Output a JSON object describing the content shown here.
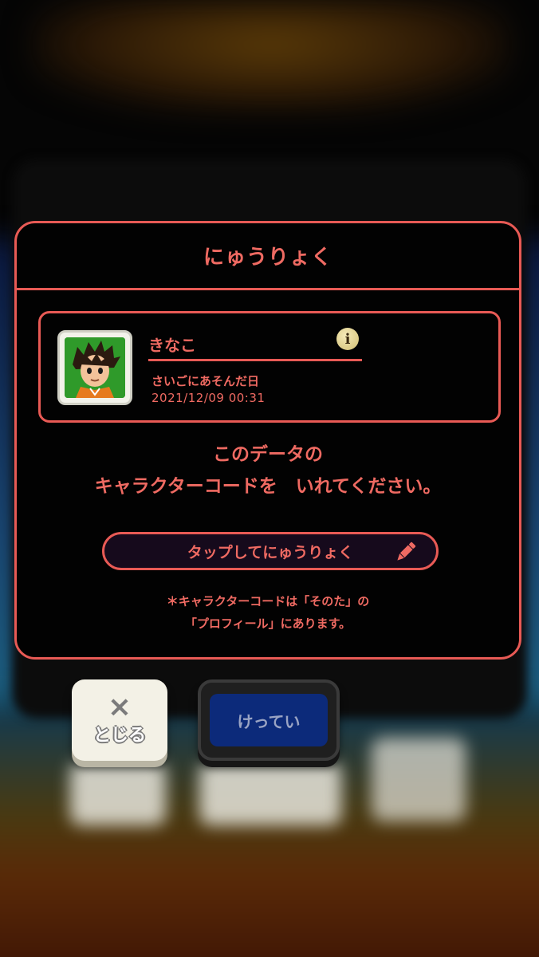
{
  "dialog": {
    "title": "にゅうりょく",
    "character": {
      "name": "きなこ",
      "last_played_label": "さいごにあそんだ日",
      "last_played_value": "2021/12/09 00:31"
    },
    "message_line1": "このデータの",
    "message_line2": "キャラクターコードを　いれてください。",
    "input_button_label": "タップしてにゅうりょく",
    "note_line1": "＊キャラクターコードは「そのた」の",
    "note_line2": "「プロフィール」にあります。"
  },
  "buttons": {
    "close_icon": "×",
    "close_label": "とじる",
    "confirm_label": "けってい"
  },
  "colors": {
    "accent": "#e85a55",
    "text": "#ef6a62",
    "confirm": "#0c2a7a"
  },
  "icons": [
    "info-icon",
    "pencil-icon",
    "close-icon",
    "character-avatar"
  ]
}
